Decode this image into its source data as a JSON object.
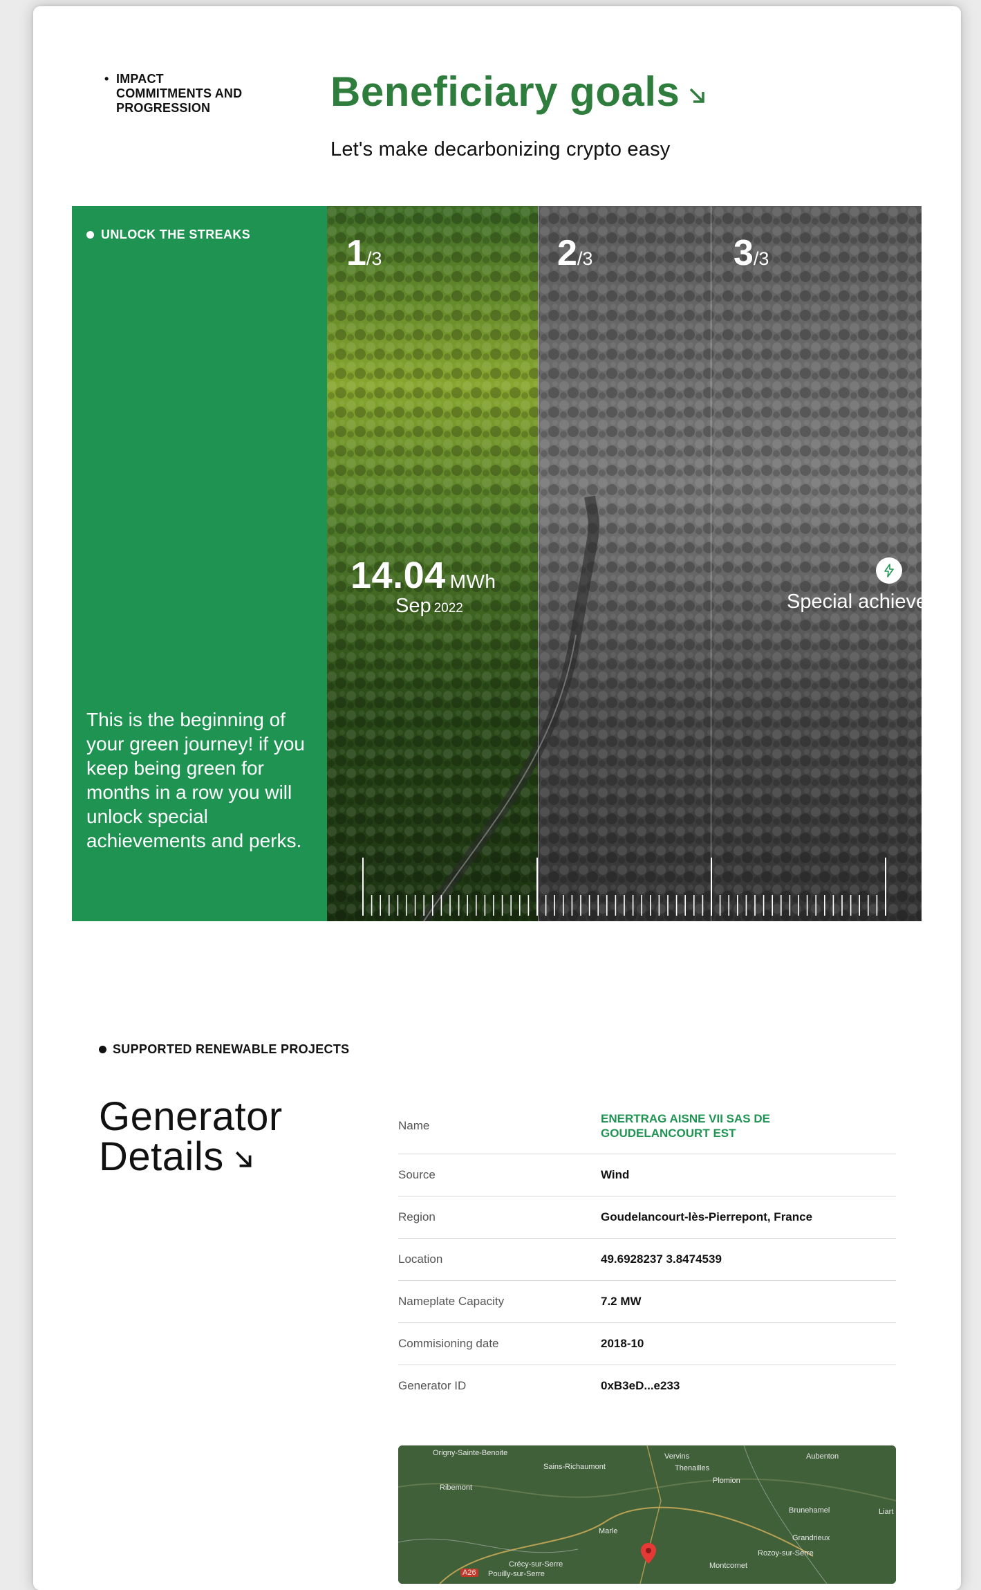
{
  "header": {
    "section_label": "IMPACT COMMITMENTS AND PROGRESSION",
    "title": "Beneficiary goals",
    "subtitle": "Let's make decarbonizing crypto easy"
  },
  "streaks": {
    "label": "UNLOCK THE STREAKS",
    "journey_text": "This is the beginning of your green journey! if you keep being green for months in a row you will unlock special achievements and perks.",
    "steps": [
      {
        "num": "1",
        "den": "/3"
      },
      {
        "num": "2",
        "den": "/3"
      },
      {
        "num": "3",
        "den": "/3"
      }
    ],
    "energy_value": "14.04",
    "energy_unit": "MWh",
    "month": "Sep",
    "year": "2022",
    "special": "Special achievement",
    "colors": {
      "green": "#1f9452",
      "title_green": "#2e7d3c"
    }
  },
  "projects": {
    "label": "SUPPORTED RENEWABLE PROJECTS",
    "title_line1": "Generator",
    "title_line2": "Details",
    "rows": [
      {
        "key": "Name",
        "value": "ENERTRAG AISNE VII SAS DE GOUDELANCOURT EST"
      },
      {
        "key": "Source",
        "value": "Wind"
      },
      {
        "key": "Region",
        "value": "Goudelancourt-lès-Pierrepont, France"
      },
      {
        "key": "Location",
        "value": "49.6928237 3.8474539"
      },
      {
        "key": "Nameplate Capacity",
        "value": "7.2 MW"
      },
      {
        "key": "Commisioning date",
        "value": "2018-10"
      },
      {
        "key": "Generator ID",
        "value": "0xB3eD...e233"
      }
    ]
  },
  "map": {
    "places": [
      "Origny-Sainte-Benoite",
      "Sains-Richaumont",
      "Vervins",
      "Thenailles",
      "Aubenton",
      "Ribemont",
      "Plomion",
      "Brunehamel",
      "Marle",
      "Grandrieux",
      "Rozoy-sur-Serre",
      "Crécy-sur-Serre",
      "Montcornet",
      "Pouilly-sur-Serre",
      "Liart",
      "A26"
    ]
  }
}
